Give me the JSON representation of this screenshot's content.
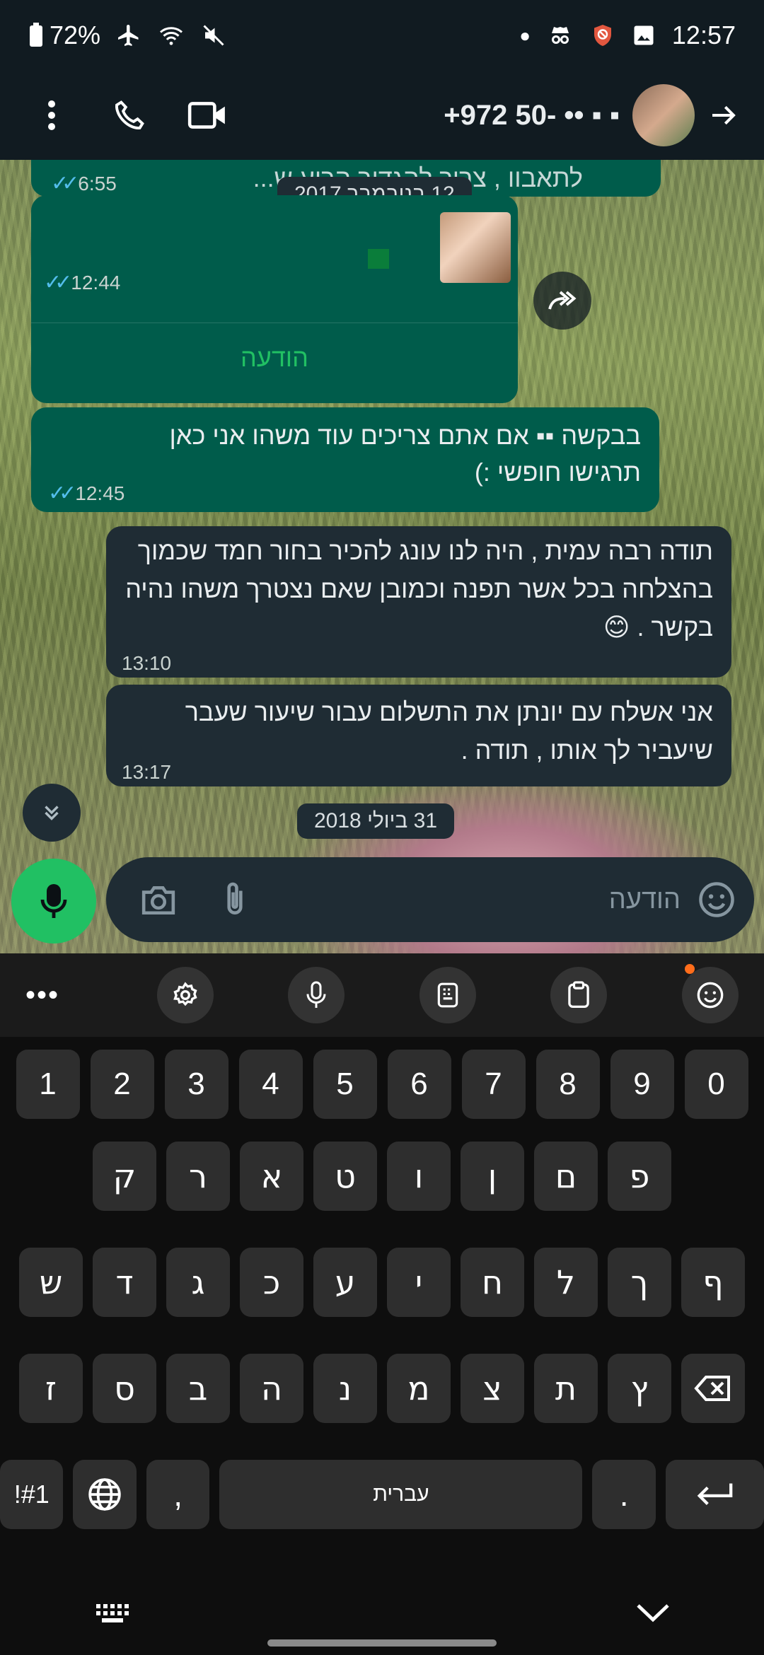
{
  "status_bar": {
    "battery": "72%",
    "time": "12:57"
  },
  "header": {
    "contact_title": "+972 50-‪ ﻿•• ▪ ▪"
  },
  "chat": {
    "partial_time": "6:55",
    "partial_text": "לתאבוו , צריך להגדיר הרוע ש...",
    "date_chip_1": "12 בנובמבר 2017",
    "msg1_time": "12:44",
    "msg1_link": "הודעה",
    "msg2_line1": "בבקשה  ▪▪ אם אתם צריכים עוד משהו אני כאן",
    "msg2_line2": "תרגישו חופשי :)",
    "msg2_time": "12:45",
    "msg3_text": "תודה רבה עמית , היה לנו עונג להכיר בחור חמד שכמוך בהצלחה בכל אשר תפנה וכמובן שאם נצטרך משהו נהיה בקשר . 😊",
    "msg3_time": "13:10",
    "msg4_text": "אני אשלח עם יונתן את התשלום עבור שיעור שעבר שיעביר לך אותו , תודה .",
    "msg4_time": "13:17",
    "date_chip_2": "31 ביולי 2018"
  },
  "composer": {
    "placeholder": "הודעה"
  },
  "keyboard": {
    "numbers": [
      "1",
      "2",
      "3",
      "4",
      "5",
      "6",
      "7",
      "8",
      "9",
      "0"
    ],
    "row1": [
      "ק",
      "ר",
      "א",
      "ט",
      "ו",
      "ן",
      "ם",
      "פ"
    ],
    "row2": [
      "ש",
      "ד",
      "ג",
      "כ",
      "ע",
      "י",
      "ח",
      "ל",
      "ך",
      "ף"
    ],
    "row3": [
      "ז",
      "ס",
      "ב",
      "ה",
      "נ",
      "מ",
      "צ",
      "ת",
      "ץ"
    ],
    "symbols_key": "!#1",
    "comma": ",",
    "space_label": "עברית",
    "period": "."
  },
  "colors": {
    "outgoing": "#005c4b",
    "incoming": "#1f2c34",
    "mic": "#21c063",
    "ticks": "#53bdeb"
  }
}
